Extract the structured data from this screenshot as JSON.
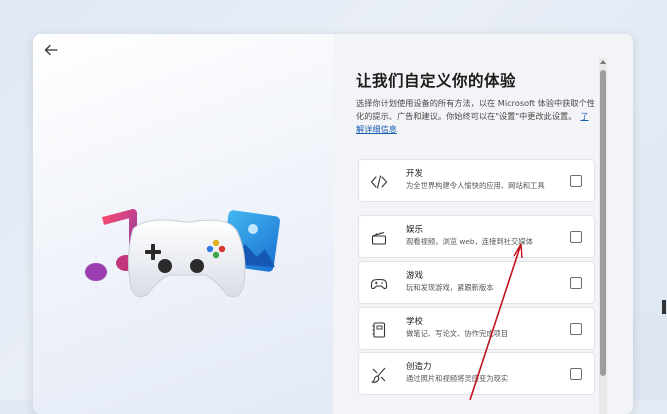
{
  "page": {
    "title": "让我们自定义你的体验",
    "description": "选择你计划使用设备的所有方法，以在 Microsoft 体验中获取个性化的提示、广告和建议。你始终可以在\"设置\"中更改此设置。",
    "learn_more": "了解详细信息"
  },
  "options": [
    {
      "title": "开发",
      "subtitle": "为全世界构建令人愉快的应用、网站和工具",
      "icon": "code-icon",
      "checked": false
    },
    {
      "title": "娱乐",
      "subtitle": "观看视频，浏览 web，连接到社交媒体",
      "icon": "clapperboard-icon",
      "checked": false
    },
    {
      "title": "游戏",
      "subtitle": "玩和发现游戏，紧跟新版本",
      "icon": "gamepad-icon",
      "checked": false
    },
    {
      "title": "学校",
      "subtitle": "做笔记、写论文、协作完成项目",
      "icon": "notebook-icon",
      "checked": false
    },
    {
      "title": "创造力",
      "subtitle": "通过照片和视频将灵感变为现实",
      "icon": "brush-icon",
      "checked": false
    }
  ],
  "colors": {
    "accent": "#1a5fb4",
    "annotation": "#c0141a"
  }
}
